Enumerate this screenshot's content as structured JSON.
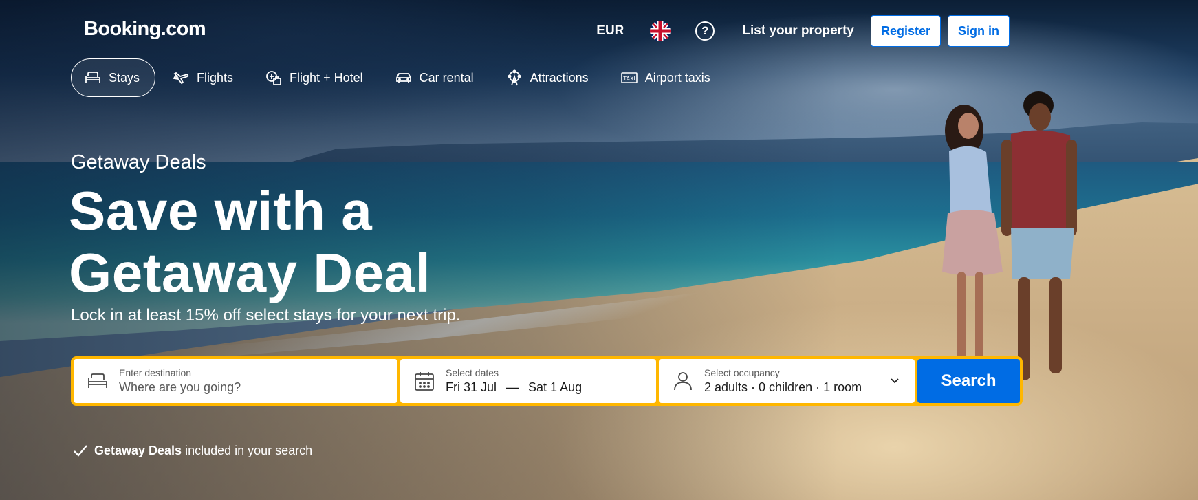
{
  "header": {
    "logo": "Booking.com",
    "currency": "EUR",
    "language_icon": "uk-flag-icon",
    "help_icon": "question-circle-icon",
    "list_property": "List your property",
    "register": "Register",
    "sign_in": "Sign in"
  },
  "nav": {
    "items": [
      {
        "label": "Stays",
        "icon": "bed-icon",
        "active": true
      },
      {
        "label": "Flights",
        "icon": "plane-icon"
      },
      {
        "label": "Flight + Hotel",
        "icon": "flight-hotel-icon"
      },
      {
        "label": "Car rental",
        "icon": "car-icon"
      },
      {
        "label": "Attractions",
        "icon": "ferris-wheel-icon"
      },
      {
        "label": "Airport taxis",
        "icon": "taxi-icon"
      }
    ]
  },
  "hero": {
    "eyebrow": "Getaway Deals",
    "headline": "Save with a Getaway Deal",
    "subline": "Lock in at least 15% off select stays for your next trip."
  },
  "search": {
    "destination": {
      "label": "Enter destination",
      "placeholder": "Where are you going?"
    },
    "dates": {
      "label": "Select dates",
      "start": "Fri 31 Jul",
      "separator": "—",
      "end": "Sat 1 Aug"
    },
    "occupancy": {
      "label": "Select occupancy",
      "value": "2 adults · 0 children · 1 room"
    },
    "button": "Search"
  },
  "deals_note": {
    "bold": "Getaway Deals",
    "rest": "included in your search"
  },
  "colors": {
    "accent_blue": "#006ce4",
    "search_border": "#ffb700"
  }
}
